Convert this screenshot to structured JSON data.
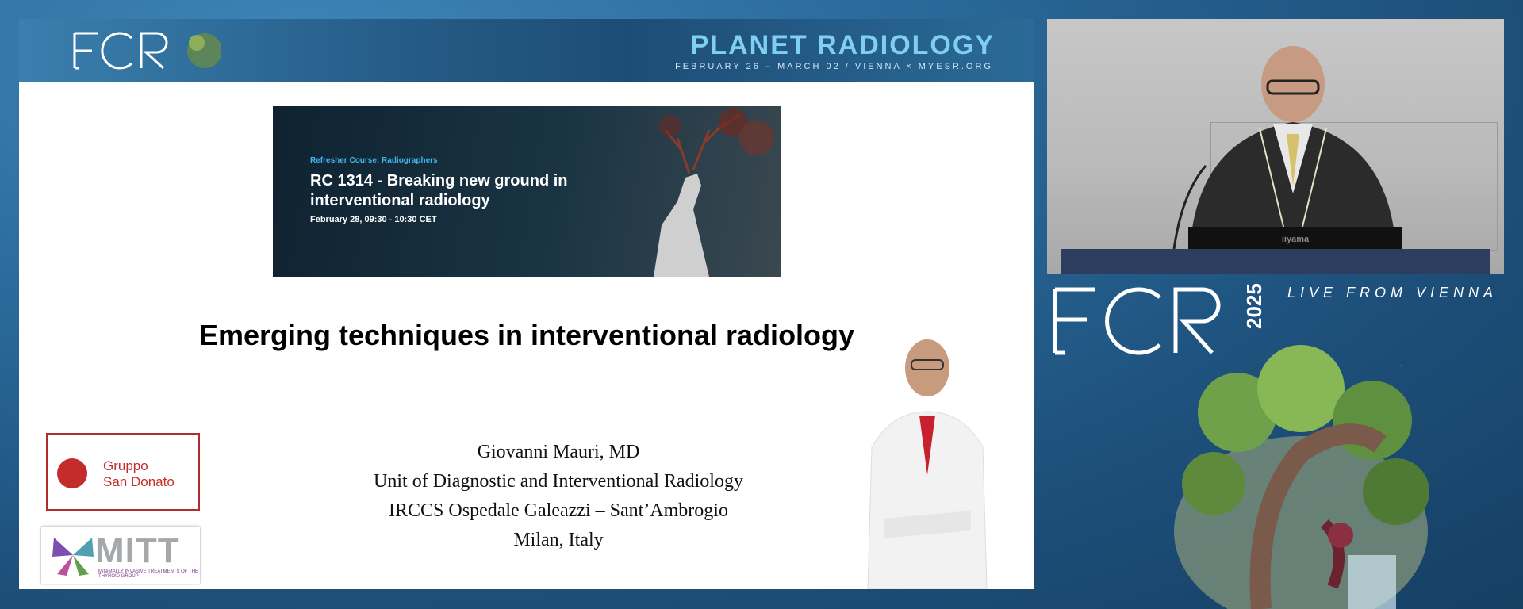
{
  "slide": {
    "header": {
      "logo_text": "ECR",
      "logo_year": "2025",
      "conference_title": "PLANET RADIOLOGY",
      "conference_subtitle": "FEBRUARY 26 – MARCH 02 / VIENNA × MYESR.ORG"
    },
    "course_banner": {
      "kicker": "Refresher Course: Radiographers",
      "title": "RC 1314 - Breaking new ground in interventional radiology",
      "date": "February 28, 09:30 - 10:30 CET"
    },
    "talk_title": "Emerging techniques in interventional radiology",
    "author": {
      "name": "Giovanni Mauri, MD",
      "unit": "Unit of Diagnostic and Interventional Radiology",
      "institution": "IRCCS Ospedale Galeazzi – Sant’Ambrogio",
      "location": "Milan, Italy"
    },
    "logos": {
      "gsd_line1": "Gruppo",
      "gsd_line2": "San Donato",
      "mitt": "MITT",
      "mitt_sub": "MINIMALLY INVASIVE TREATMENTS OF THE THYROID GROUP"
    }
  },
  "camera": {
    "monitor_brand": "iiyama"
  },
  "branding": {
    "logo_text": "ECR",
    "logo_year": "2025",
    "live_text": "LIVE FROM VIENNA"
  },
  "colors": {
    "accent": "#3fb8f0",
    "brand_red": "#c42b2b",
    "background": "#245a85"
  }
}
